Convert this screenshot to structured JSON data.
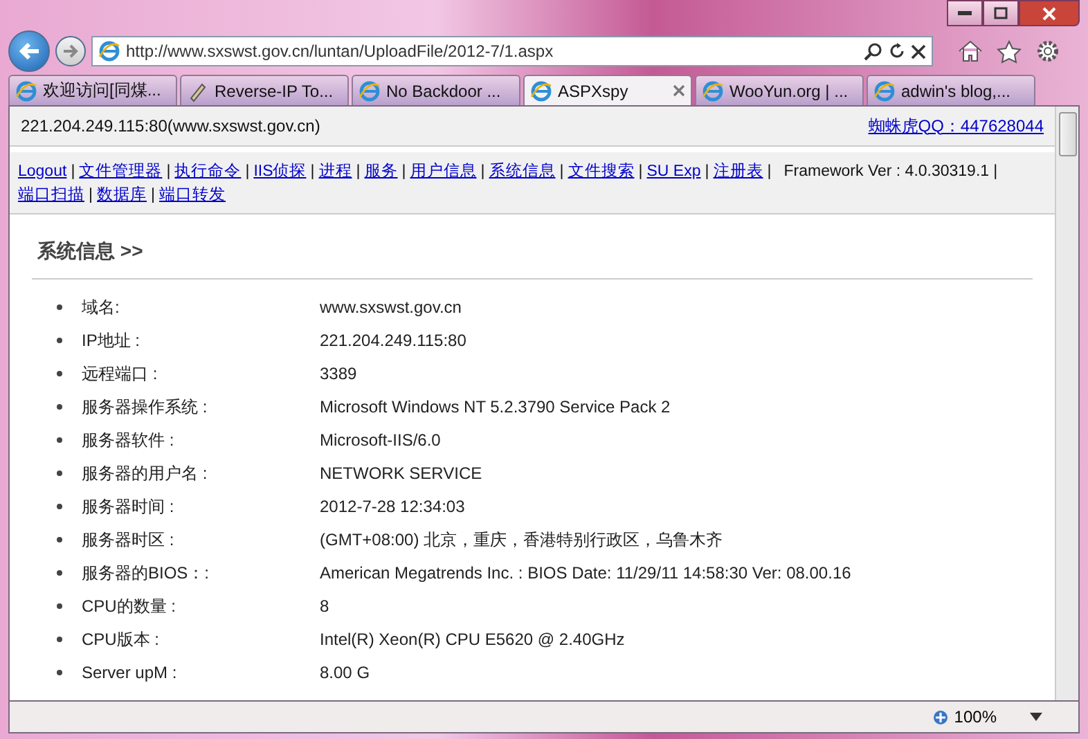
{
  "browser": {
    "address": "http://www.sxswst.gov.cn/luntan/UploadFile/2012-7/1.aspx",
    "zoom": "100%"
  },
  "tabs": [
    {
      "label": "欢迎访问[同煤...",
      "selected": false
    },
    {
      "label": "Reverse-IP To...",
      "selected": false
    },
    {
      "label": "No Backdoor ...",
      "selected": false
    },
    {
      "label": "ASPXspy",
      "selected": true
    },
    {
      "label": "WooYun.org | ...",
      "selected": false
    },
    {
      "label": "adwin's blog,...",
      "selected": false
    }
  ],
  "header": {
    "host": "221.204.249.115:80(www.sxswst.gov.cn)",
    "contact": "蜘蛛虎QQ：447628044"
  },
  "nav": {
    "separator": "|",
    "links": [
      "Logout",
      "文件管理器",
      "执行命令",
      "IIS侦探",
      "进程",
      "服务",
      "用户信息",
      "系统信息",
      "文件搜索",
      "SU Exp",
      "注册表",
      "端口扫描",
      "数据库",
      "端口转发"
    ],
    "framework": "Framework Ver : 4.0.30319.1"
  },
  "section": {
    "title": "系统信息 >>",
    "items": [
      {
        "label": "域名:",
        "value": "www.sxswst.gov.cn"
      },
      {
        "label": "IP地址 :",
        "value": "221.204.249.115:80"
      },
      {
        "label": "远程端口 :",
        "value": "3389"
      },
      {
        "label": "服务器操作系统 :",
        "value": "Microsoft Windows NT 5.2.3790 Service Pack 2"
      },
      {
        "label": "服务器软件 :",
        "value": "Microsoft-IIS/6.0"
      },
      {
        "label": "服务器的用户名 :",
        "value": "NETWORK SERVICE"
      },
      {
        "label": "服务器时间 :",
        "value": "2012-7-28 12:34:03"
      },
      {
        "label": "服务器时区 :",
        "value": "(GMT+08:00) 北京，重庆，香港特别行政区，乌鲁木齐"
      },
      {
        "label": "服务器的BIOS：:",
        "value": "American Megatrends Inc. : BIOS Date: 11/29/11 14:58:30 Ver: 08.00.16"
      },
      {
        "label": "CPU的数量 :",
        "value": "8"
      },
      {
        "label": "CPU版本 :",
        "value": "Intel(R) Xeon(R) CPU E5620 @ 2.40GHz"
      },
      {
        "label": "Server upM :",
        "value": "8.00 G"
      }
    ]
  }
}
